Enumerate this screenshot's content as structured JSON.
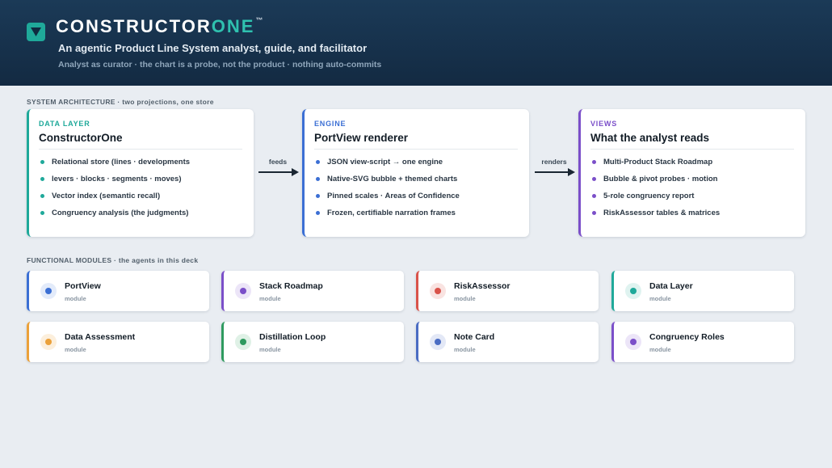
{
  "header": {
    "brand_main": "CONSTRUCTOR",
    "brand_accent": "ONE",
    "brand_mark": "™",
    "subtitle": "An agentic Product Line System analyst, guide, and facilitator",
    "tagline": "Analyst as curator · the chart is a probe, not the product · nothing auto-commits",
    "logo_icon": "chevron-down-logo-icon"
  },
  "architecture": {
    "section_title": "SYSTEM ARCHITECTURE",
    "section_subtitle": " · two projections, one store",
    "cards": [
      {
        "kicker": "DATA LAYER",
        "title": "ConstructorOne",
        "color": "#1fa99a",
        "items": [
          "Relational store (lines · developments",
          "levers · blocks · segments · moves)",
          "Vector index (semantic recall)",
          "Congruency analysis (the judgments)"
        ]
      },
      {
        "kicker": "ENGINE",
        "title": "PortView renderer",
        "color": "#3b6fd4",
        "items": [
          "JSON view-script → one engine",
          "Native-SVG bubble + themed charts",
          "Pinned scales · Areas of Confidence",
          "Frozen, certifiable narration frames"
        ]
      },
      {
        "kicker": "VIEWS",
        "title": "What the analyst reads",
        "color": "#7b4fc9",
        "items": [
          "Multi-Product Stack Roadmap",
          "Bubble & pivot probes · motion",
          "5-role congruency report",
          "RiskAssessor tables & matrices"
        ]
      }
    ],
    "arrows": [
      {
        "label": "feeds"
      },
      {
        "label": "renders"
      }
    ]
  },
  "modules": {
    "section_title": "FUNCTIONAL MODULES",
    "section_subtitle": " · the agents in this deck",
    "items": [
      {
        "name": "PortView",
        "sub": "module",
        "color": "#3b6fd4",
        "tint": "#e3ebfa"
      },
      {
        "name": "Stack Roadmap",
        "sub": "module",
        "color": "#7b4fc9",
        "tint": "#ece5f8"
      },
      {
        "name": "RiskAssessor",
        "sub": "module",
        "color": "#d9534a",
        "tint": "#f9e3e1"
      },
      {
        "name": "Data Layer",
        "sub": "module",
        "color": "#1fa99a",
        "tint": "#dff3f0"
      },
      {
        "name": "Data Assessment",
        "sub": "module",
        "color": "#eba13a",
        "tint": "#fcefdc"
      },
      {
        "name": "Distillation Loop",
        "sub": "module",
        "color": "#2e9a5f",
        "tint": "#dff1e6"
      },
      {
        "name": "Note Card",
        "sub": "module",
        "color": "#4a6cc3",
        "tint": "#e3e8f6"
      },
      {
        "name": "Congruency Roles",
        "sub": "module",
        "color": "#7b4fc9",
        "tint": "#ece5f8"
      }
    ]
  }
}
